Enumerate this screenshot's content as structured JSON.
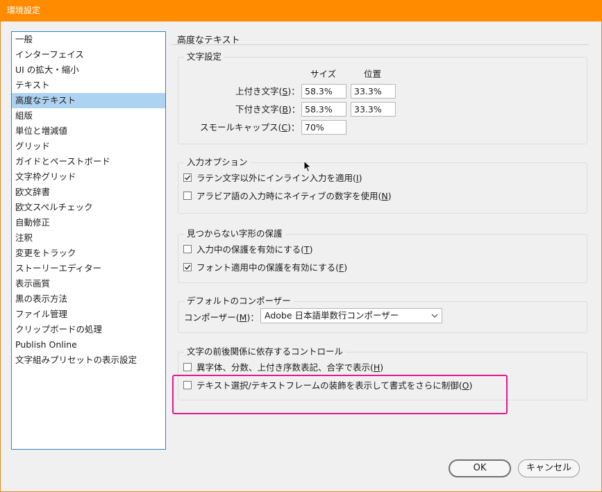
{
  "window": {
    "title": "環境設定"
  },
  "sidebar": {
    "items": [
      {
        "label": "一般",
        "selected": false
      },
      {
        "label": "インターフェイス",
        "selected": false
      },
      {
        "label": "UI の拡大・縮小",
        "selected": false
      },
      {
        "label": "テキスト",
        "selected": false
      },
      {
        "label": "高度なテキスト",
        "selected": true
      },
      {
        "label": "組版",
        "selected": false
      },
      {
        "label": "単位と増減値",
        "selected": false
      },
      {
        "label": "グリッド",
        "selected": false
      },
      {
        "label": "ガイドとペーストボード",
        "selected": false
      },
      {
        "label": "文字枠グリッド",
        "selected": false
      },
      {
        "label": "欧文辞書",
        "selected": false
      },
      {
        "label": "欧文スペルチェック",
        "selected": false
      },
      {
        "label": "自動修正",
        "selected": false
      },
      {
        "label": "注釈",
        "selected": false
      },
      {
        "label": "変更をトラック",
        "selected": false
      },
      {
        "label": "ストーリーエディター",
        "selected": false
      },
      {
        "label": "表示画質",
        "selected": false
      },
      {
        "label": "黒の表示方法",
        "selected": false
      },
      {
        "label": "ファイル管理",
        "selected": false
      },
      {
        "label": "クリップボードの処理",
        "selected": false
      },
      {
        "label": "Publish Online",
        "selected": false
      },
      {
        "label": "文字組みプリセットの表示設定",
        "selected": false
      }
    ]
  },
  "main": {
    "section_title": "高度なテキスト",
    "char_settings": {
      "label": "文字設定",
      "col_size": "サイズ",
      "col_position": "位置",
      "superscript": {
        "label": "上付き文字(",
        "key": "S",
        "tail": ")：",
        "size": "58.3%",
        "position": "33.3%"
      },
      "subscript": {
        "label": "下付き文字(",
        "key": "B",
        "tail": ")：",
        "size": "58.3%",
        "position": "33.3%"
      },
      "small_caps": {
        "label": "スモールキャップス(",
        "key": "C",
        "tail": ")：",
        "size": "70%"
      }
    },
    "input_options": {
      "label": "入力オプション",
      "opt1": {
        "text": "ラテン文字以外にインライン入力を適用(",
        "key": "I",
        "tail": ")",
        "checked": true
      },
      "opt2": {
        "text": "アラビア語の入力時にネイティブの数字を使用(",
        "key": "N",
        "tail": ")",
        "checked": false
      }
    },
    "missing_glyph": {
      "label": "見つからない字形の保護",
      "opt1": {
        "text": "入力中の保護を有効にする(",
        "key": "T",
        "tail": ")",
        "checked": false
      },
      "opt2": {
        "text": "フォント適用中の保護を有効にする(",
        "key": "F",
        "tail": ")",
        "checked": true
      }
    },
    "composer": {
      "label": "デフォルトのコンポーザー",
      "field_label": "コンポーザー(",
      "key": "M",
      "tail": ")：",
      "value": "Adobe 日本語単数行コンポーザー"
    },
    "context_controls": {
      "label": "文字の前後関係に依存するコントロール",
      "opt1": {
        "text": "異字体、分数、上付き序数表記、合字で表示(",
        "key": "H",
        "tail": ")",
        "checked": false
      },
      "opt2": {
        "text": "テキスト選択/テキストフレームの装飾を表示して書式をさらに制御(",
        "key": "O",
        "tail": ")",
        "checked": false
      }
    }
  },
  "footer": {
    "ok": "OK",
    "cancel": "キャンセル"
  },
  "colors": {
    "titlebar": "#ff8c00",
    "selection": "#aed3f2",
    "highlight_box": "#e0198c"
  }
}
